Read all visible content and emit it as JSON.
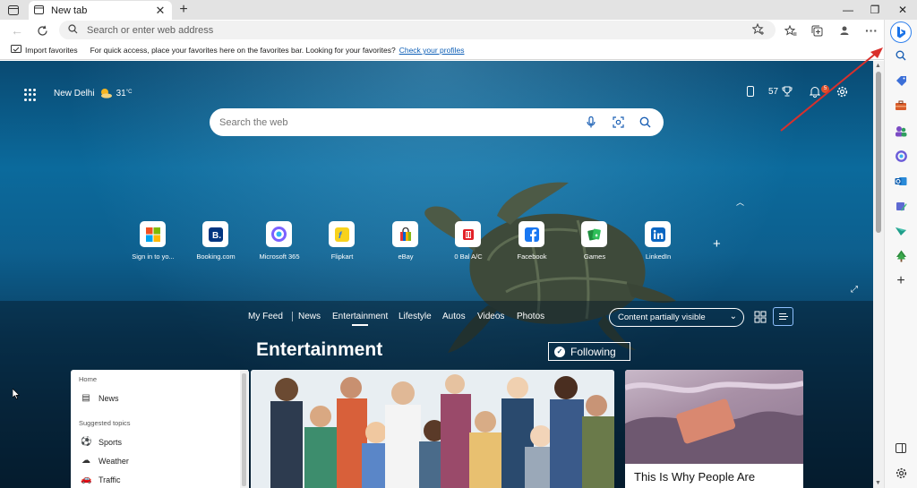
{
  "browser": {
    "tab": {
      "title": "New tab"
    },
    "address": {
      "placeholder": "Search or enter web address"
    },
    "favorites_bar": {
      "import_label": "Import favorites",
      "message": "For quick access, place your favorites here on the favorites bar. Looking for your favorites?",
      "link": "Check your profiles"
    }
  },
  "newtab": {
    "weather": {
      "city": "New Delhi",
      "temp": "31",
      "unit": "°C"
    },
    "rewards_points": "57",
    "notifications_count": "5",
    "search": {
      "placeholder": "Search the web"
    },
    "quick_links": [
      {
        "label": "Sign in to yo...",
        "icon": "microsoft-logo-icon",
        "color": "#f25022"
      },
      {
        "label": "Booking.com",
        "icon": "booking-logo-icon",
        "color": "#003580"
      },
      {
        "label": "Microsoft 365",
        "icon": "microsoft-365-icon",
        "color": "#7b61ff"
      },
      {
        "label": "Flipkart",
        "icon": "flipkart-logo-icon",
        "color": "#f8d21c"
      },
      {
        "label": "eBay",
        "icon": "ebay-bag-icon",
        "color": "#2a2a2a"
      },
      {
        "label": "0 Bal A/C",
        "icon": "bank-card-icon",
        "color": "#e32027"
      },
      {
        "label": "Facebook",
        "icon": "facebook-logo-icon",
        "color": "#1877f2"
      },
      {
        "label": "Games",
        "icon": "games-cards-icon",
        "color": "#1e8e3e"
      },
      {
        "label": "LinkedIn",
        "icon": "linkedin-logo-icon",
        "color": "#0a66c2"
      }
    ],
    "feed_nav": {
      "items": [
        "My Feed",
        "News",
        "Entertainment",
        "Lifestyle",
        "Autos",
        "Videos",
        "Photos"
      ],
      "active": "Entertainment",
      "visibility": "Content partially visible"
    },
    "section": {
      "title": "Entertainment",
      "following": "Following"
    },
    "left_panel": {
      "home": "Home",
      "news": "News",
      "suggested": "Suggested topics",
      "topics": [
        "Sports",
        "Weather",
        "Traffic"
      ]
    },
    "side_card": {
      "title": "This Is Why People Are"
    }
  },
  "colors": {
    "accent": "#0c5eb6",
    "annotation_arrow": "#d9302c"
  }
}
